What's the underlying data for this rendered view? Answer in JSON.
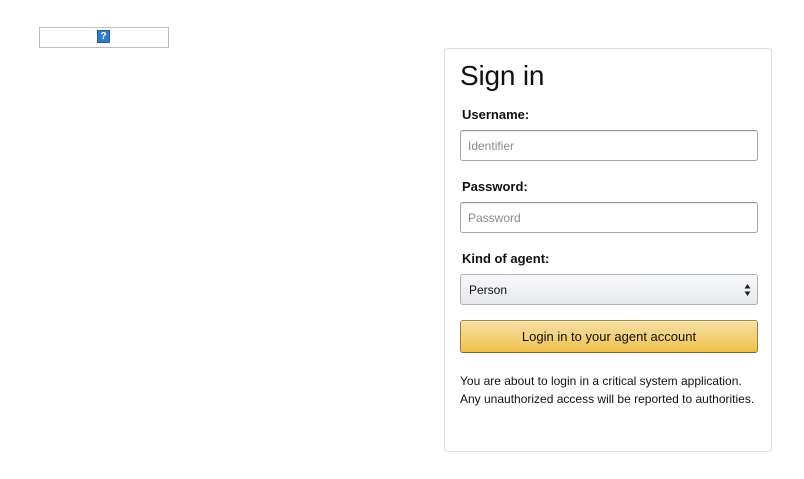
{
  "logo": {
    "icon": "broken-image-icon",
    "icon_glyph": "?"
  },
  "signin": {
    "title": "Sign in",
    "username": {
      "label": "Username:",
      "placeholder": "Identifier",
      "value": ""
    },
    "password": {
      "label": "Password:",
      "placeholder": "Password",
      "value": ""
    },
    "agent_kind": {
      "label": "Kind of agent:",
      "selected": "Person"
    },
    "submit_label": "Login in to your agent account",
    "notice": "You are about to login in a critical system application. Any unauthorized access will be reported to authorities."
  },
  "colors": {
    "button_top": "#f7dfa5",
    "button_bottom": "#f0c14b",
    "button_border": "#a88734",
    "icon_blue": "#2f7bc4"
  }
}
